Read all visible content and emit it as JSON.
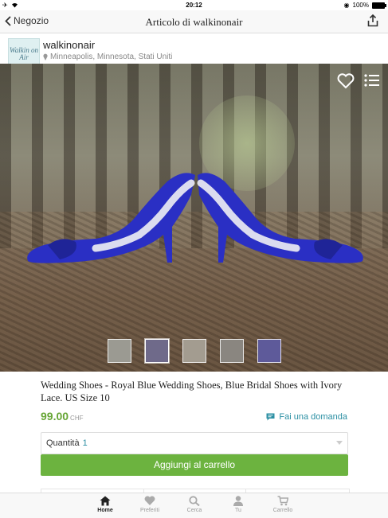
{
  "status": {
    "time": "20:12",
    "battery": "100%"
  },
  "nav": {
    "back_label": "Negozio",
    "title": "Articolo di walkinonair"
  },
  "shop": {
    "logo_text": "Walkin on Air",
    "name": "walkinonair",
    "location": "Minneapolis, Minnesota, Stati Uniti"
  },
  "product": {
    "title": "Wedding Shoes - Royal Blue Wedding Shoes, Blue Bridal Shoes with Ivory Lace. US Size 10",
    "price": "99.00",
    "currency": "CHF",
    "ask_label": "Fai una domanda",
    "quantity_label": "Quantità",
    "quantity_value": "1",
    "add_to_cart": "Aggiungi al carrello"
  },
  "tabs": [
    {
      "label": "Home",
      "icon": "home-icon",
      "active": true
    },
    {
      "label": "Preferiti",
      "icon": "heart-icon",
      "active": false
    },
    {
      "label": "Cerca",
      "icon": "search-icon",
      "active": false
    },
    {
      "label": "Tu",
      "icon": "user-icon",
      "active": false
    },
    {
      "label": "Carrello",
      "icon": "cart-icon",
      "active": false
    }
  ],
  "colors": {
    "accent_green": "#6cb33f",
    "price_green": "#67a636",
    "link_teal": "#2b8fa3",
    "shoe_blue": "#2a2fc4"
  }
}
